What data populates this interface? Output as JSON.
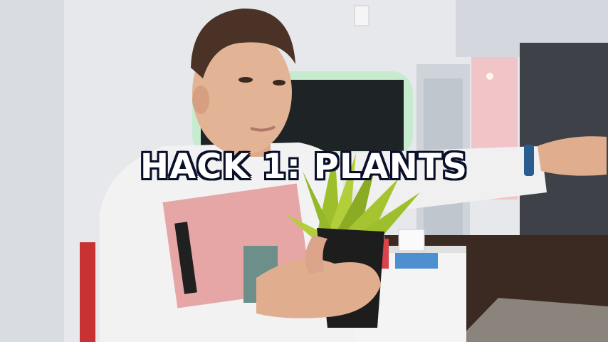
{
  "video_frame": {
    "caption": "HACK 1: PLANTS"
  },
  "colors": {
    "wall": "#e4e7ea",
    "tv_glow": "#8df29a",
    "sweater": "#f2f2f3",
    "print_panel": "#e6a6a6",
    "plant_green": "#9ebf2c",
    "pot": "#1d1d1d",
    "floor": "#3a2a22",
    "hallway_pink": "#f1c4c8",
    "caption_outline": "#0a0f2a"
  }
}
